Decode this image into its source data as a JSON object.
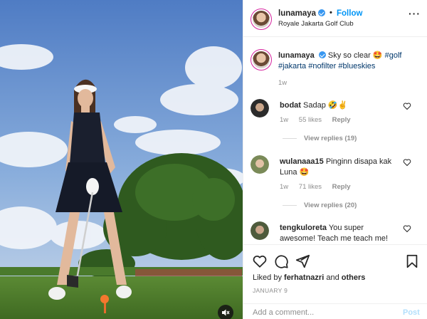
{
  "post": {
    "username": "lunamaya",
    "verified": true,
    "follow_label": "Follow",
    "separator": "•",
    "location": "Royale Jakarta Golf Club"
  },
  "caption": {
    "username": "lunamaya",
    "text_parts": [
      {
        "text": "Sky so clear 🤩 ",
        "type": "text"
      },
      {
        "text": "#golf",
        "type": "tag"
      },
      {
        "text": " ",
        "type": "text"
      },
      {
        "text": "#jakarta",
        "type": "tag"
      },
      {
        "text": " ",
        "type": "text"
      },
      {
        "text": "#nofilter",
        "type": "tag"
      },
      {
        "text": " ",
        "type": "text"
      },
      {
        "text": "#blueskies",
        "type": "tag"
      }
    ],
    "time": "1w"
  },
  "comments": [
    {
      "username": "bodat",
      "text": "Sadap 🤣✌",
      "time": "1w",
      "likes": "55 likes",
      "reply_label": "Reply",
      "view_replies": "View replies (19)",
      "avatar_color": "#3a3a3a"
    },
    {
      "username": "wulanaaa15",
      "text": "Pinginn disapa kak Luna 🤩",
      "time": "1w",
      "likes": "71 likes",
      "reply_label": "Reply",
      "view_replies": "View replies (20)",
      "avatar_color": "#7a8a58"
    },
    {
      "username": "tengkuloreta",
      "text": "You super awesome! Teach me teach me!",
      "avatar_color": "#4e5b3c"
    }
  ],
  "actions": {
    "liked_by_prefix": "Liked by ",
    "liked_by_user": "ferhatnazri",
    "liked_by_and": " and ",
    "liked_by_others": "others",
    "date": "JANUARY 9"
  },
  "comment_box": {
    "placeholder": "Add a comment...",
    "post_label": "Post"
  },
  "colors": {
    "accent": "#0095f6",
    "hashtag": "#00376b",
    "muted": "#8e8e8e"
  },
  "icons": [
    "verified-icon",
    "more-options-icon",
    "like-icon",
    "comment-icon",
    "share-icon",
    "save-icon",
    "mute-icon"
  ]
}
